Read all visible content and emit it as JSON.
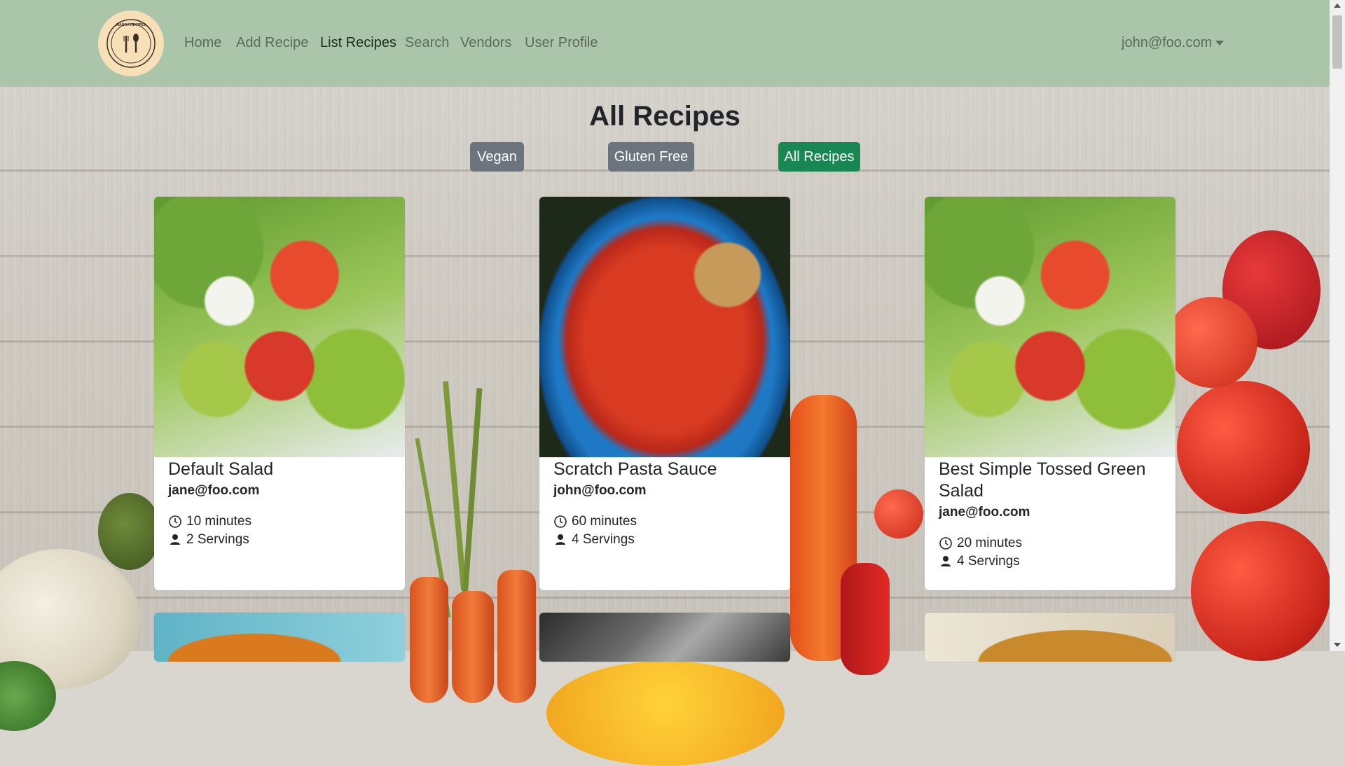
{
  "nav": {
    "logo_text": "MANOA RECIPES",
    "links": [
      {
        "label": "Home"
      },
      {
        "label": "Add Recipe"
      },
      {
        "label": "List Recipes"
      },
      {
        "label": "Search"
      },
      {
        "label": "Vendors"
      },
      {
        "label": "User Profile"
      }
    ],
    "active": "List Recipes",
    "user": "john@foo.com"
  },
  "page": {
    "title": "All Recipes",
    "filters": [
      {
        "label": "Vegan"
      },
      {
        "label": "Gluten Free"
      },
      {
        "label": "All Recipes",
        "active": true
      }
    ]
  },
  "recipes": [
    {
      "title": "Default Salad",
      "author": "jane@foo.com",
      "time": "10 minutes",
      "servings": "2 Servings"
    },
    {
      "title": "Scratch Pasta Sauce",
      "author": "john@foo.com",
      "time": "60 minutes",
      "servings": "4 Servings"
    },
    {
      "title": "Best Simple Tossed Green Salad",
      "author": "jane@foo.com",
      "time": "20 minutes",
      "servings": "4 Servings"
    }
  ],
  "colors": {
    "navbar": "#abc5aa",
    "accent_green": "#198754",
    "filter_grey": "#6c757d",
    "logo_bg": "#f7dfb8"
  },
  "icons": {
    "time": "clock-icon",
    "servings": "person-icon"
  }
}
